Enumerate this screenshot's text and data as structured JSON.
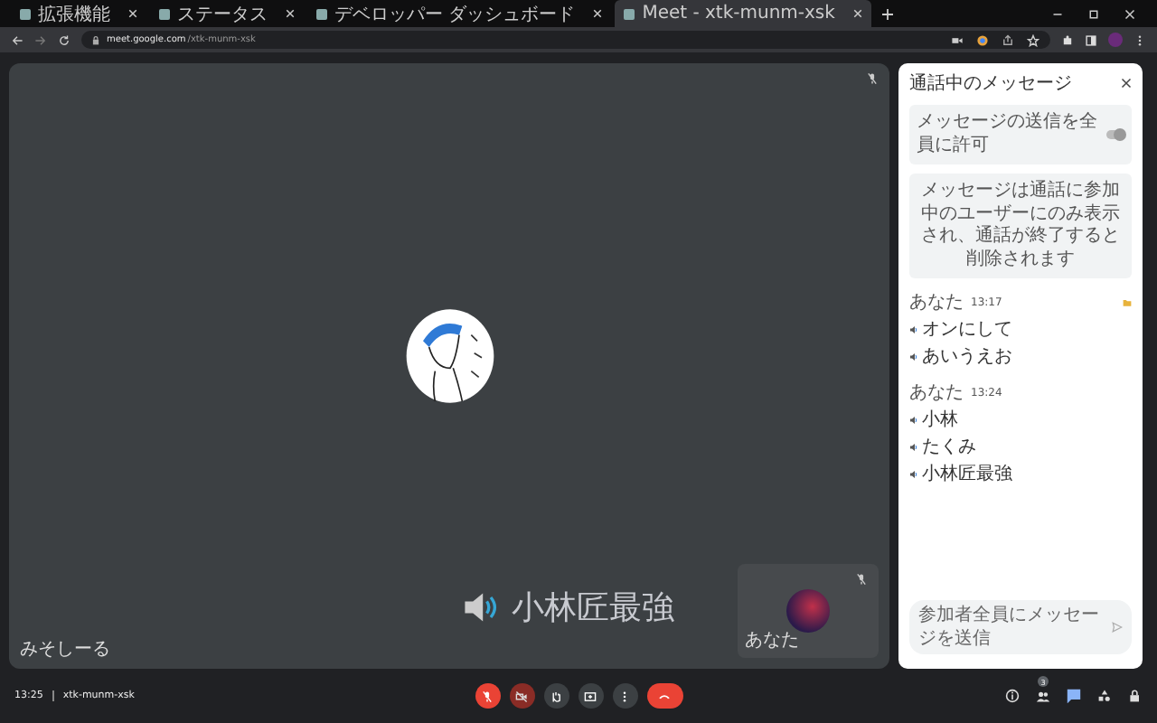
{
  "browser": {
    "tabs": [
      {
        "title": "拡張機能",
        "selected": false
      },
      {
        "title": "ステータス",
        "selected": false
      },
      {
        "title": "デベロッパー ダッシュボード",
        "selected": false
      },
      {
        "title": "Meet - xtk-munm-xsk",
        "selected": true
      }
    ],
    "url_host": "meet.google.com",
    "url_path": "/xtk-munm-xsk"
  },
  "main_tile": {
    "name": "みそしーる",
    "muted": true,
    "caption": "小林匠最強"
  },
  "self_tile": {
    "name": "あなた",
    "muted": true
  },
  "chat": {
    "title": "通話中のメッセージ",
    "allow_setting": {
      "label": "メッセージの送信を全員に許可",
      "on": true
    },
    "notice": "メッセージは通話に参加中のユーザーにのみ表示され、通話が終了すると削除されます",
    "groups": [
      {
        "sender": "あなた",
        "time": "13:17",
        "pinned": true,
        "messages": [
          "オンにして",
          "あいうえお"
        ]
      },
      {
        "sender": "あなた",
        "time": "13:24",
        "pinned": false,
        "messages": [
          "小林",
          "たくみ",
          "小林匠最強"
        ]
      }
    ],
    "input_placeholder": "参加者全員にメッセージを送信"
  },
  "bottom_bar": {
    "time": "13:25",
    "meeting_code": "xtk-munm-xsk",
    "mic_on": false,
    "camera_on": false,
    "people_count": "3",
    "chat_open": true
  }
}
